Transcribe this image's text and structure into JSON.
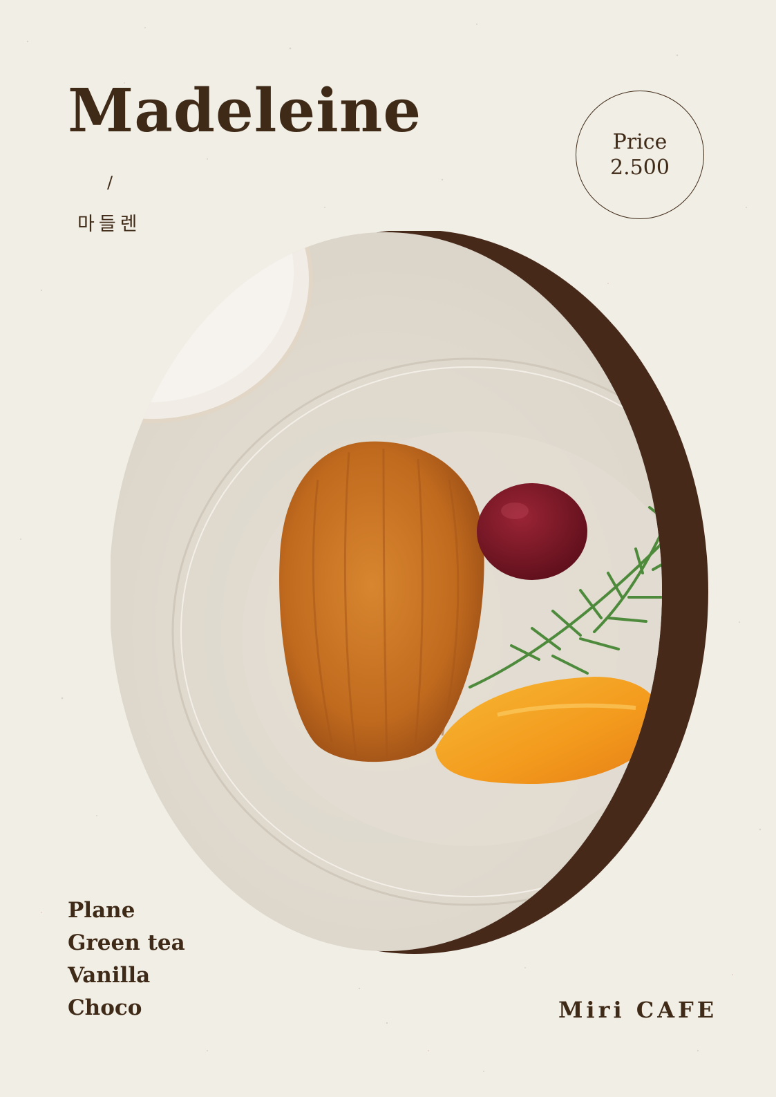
{
  "menu": {
    "title": "Madeleine",
    "separator": "/",
    "korean_name": "마들렌",
    "price_label": "Price",
    "price_value": "2.500",
    "flavors": [
      "Plane",
      "Green tea",
      "Vanilla",
      "Choco"
    ],
    "brand": "Miri CAFE"
  },
  "colors": {
    "background": "#f1eee6",
    "text": "#3f2a17",
    "accent_crescent": "#47291a"
  },
  "icons": {
    "photo": "madeleine-plate-photo"
  }
}
